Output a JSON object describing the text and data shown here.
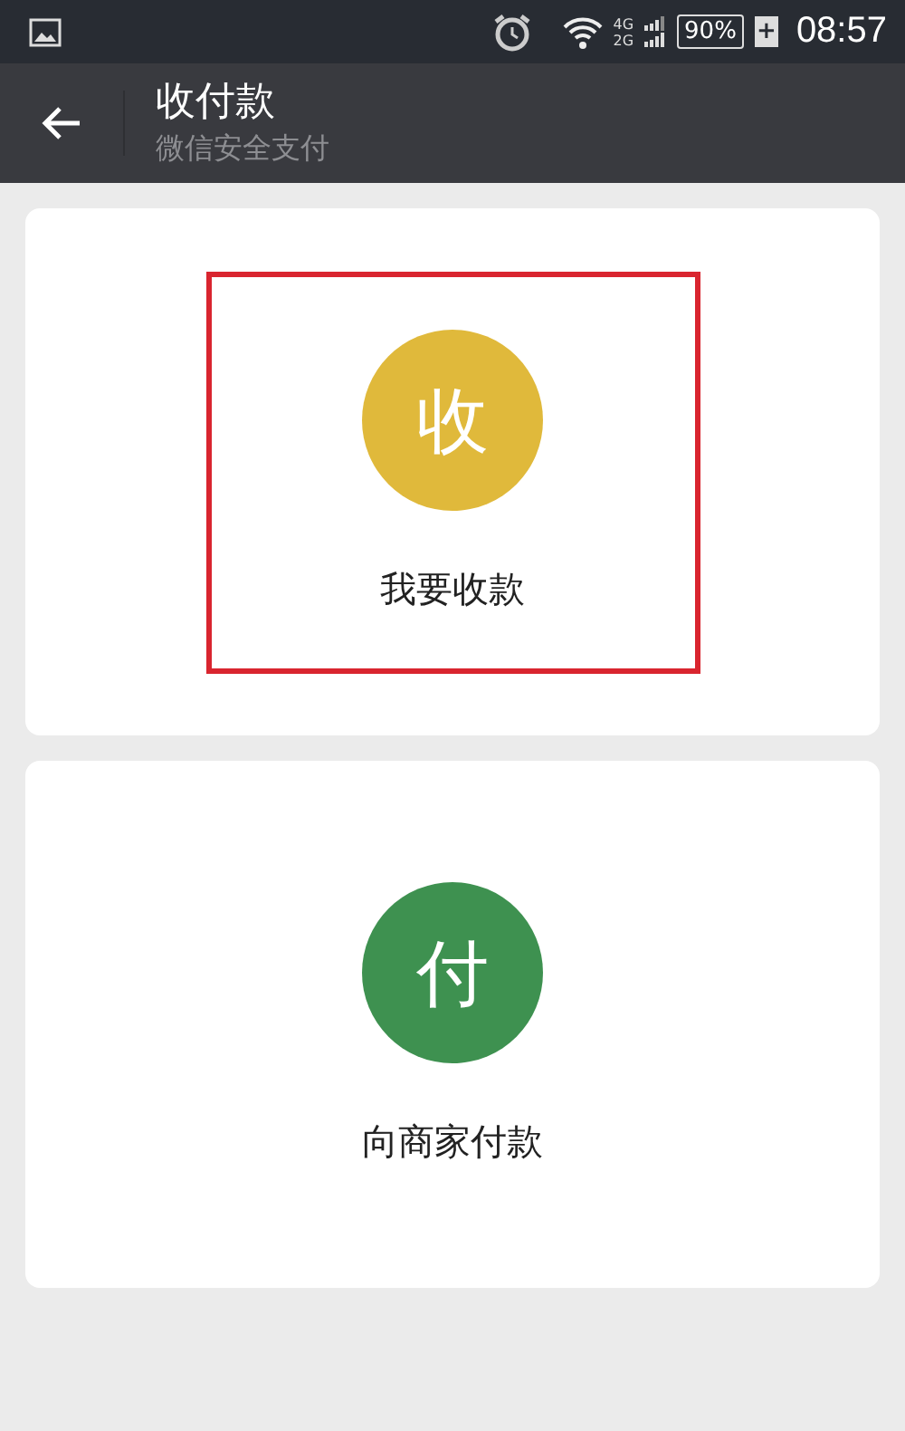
{
  "status_bar": {
    "network_top": "4G",
    "network_bottom": "2G",
    "battery": "90%",
    "charging": "+",
    "time": "08:57"
  },
  "header": {
    "title": "收付款",
    "subtitle": "微信安全支付"
  },
  "options": [
    {
      "glyph": "收",
      "label": "我要收款",
      "color": "#e0b93b",
      "highlighted": true
    },
    {
      "glyph": "付",
      "label": "向商家付款",
      "color": "#3e9150",
      "highlighted": false
    }
  ]
}
